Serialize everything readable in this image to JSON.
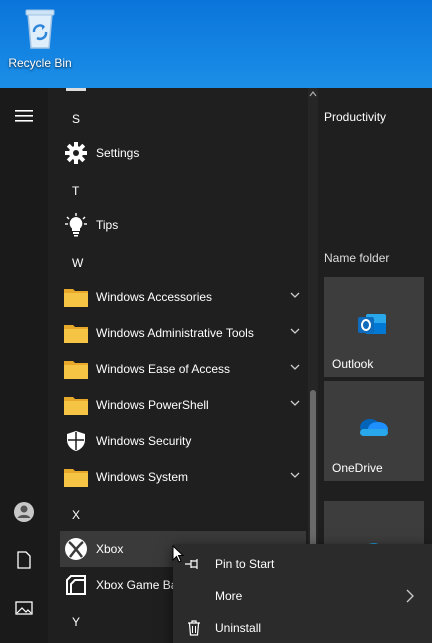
{
  "desktop": {
    "recycle_bin_label": "Recycle Bin"
  },
  "app_list": {
    "items": [
      {
        "kind": "letter",
        "text": "S"
      },
      {
        "kind": "app",
        "label": "Settings",
        "icon": "gear-icon"
      },
      {
        "kind": "letter",
        "text": "T"
      },
      {
        "kind": "app",
        "label": "Tips",
        "icon": "lightbulb-icon"
      },
      {
        "kind": "letter",
        "text": "W"
      },
      {
        "kind": "folder",
        "label": "Windows Accessories",
        "icon": "folder-icon"
      },
      {
        "kind": "folder",
        "label": "Windows Administrative Tools",
        "icon": "folder-icon"
      },
      {
        "kind": "folder",
        "label": "Windows Ease of Access",
        "icon": "folder-icon"
      },
      {
        "kind": "folder",
        "label": "Windows PowerShell",
        "icon": "folder-icon"
      },
      {
        "kind": "app",
        "label": "Windows Security",
        "icon": "shield-icon"
      },
      {
        "kind": "folder",
        "label": "Windows System",
        "icon": "folder-icon"
      },
      {
        "kind": "letter",
        "text": "X"
      },
      {
        "kind": "app",
        "label": "Xbox",
        "icon": "xbox-icon"
      },
      {
        "kind": "app",
        "label": "Xbox Game Bar",
        "icon": "game-bar-icon"
      },
      {
        "kind": "letter",
        "text": "Y"
      }
    ]
  },
  "tiles": {
    "groups": [
      {
        "title": "Productivity"
      },
      {
        "title": "Name folder"
      }
    ],
    "items": [
      {
        "label": "Outlook",
        "icon": "outlook-icon"
      },
      {
        "label": "OneDrive",
        "icon": "onedrive-icon"
      },
      {
        "label": "",
        "icon": "edge-icon"
      }
    ]
  },
  "context_menu": {
    "items": [
      {
        "label": "Pin to Start",
        "icon": "pin-icon"
      },
      {
        "label": "More",
        "icon": "chevron-right-icon"
      },
      {
        "label": "Uninstall",
        "icon": "trash-icon"
      }
    ]
  },
  "colors": {
    "desktop_blue": "#0a74da",
    "folder_yellow": "#f6c445",
    "outlook_blue": "#0f6cbd",
    "onedrive_blue": "#1e90ff"
  }
}
